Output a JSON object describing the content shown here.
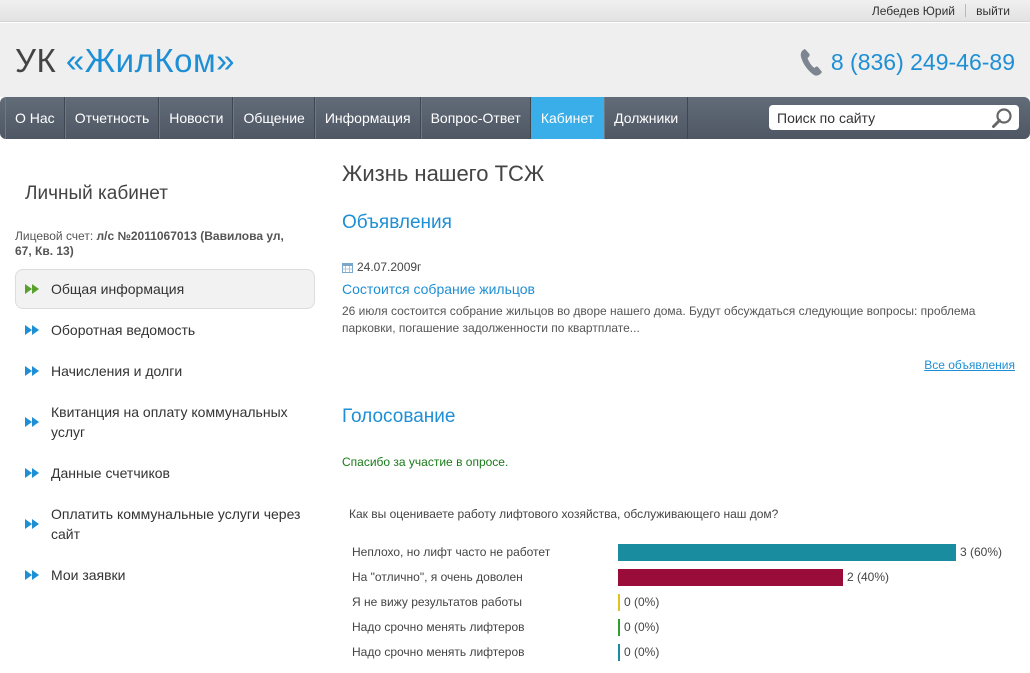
{
  "userbar": {
    "name": "Лебедев Юрий",
    "logout": "выйти"
  },
  "header": {
    "logo_prefix": "УК ",
    "logo_brand": "«ЖилКом»",
    "phone": "8 (836) 249-46-89",
    "phone_icon": "phone-icon"
  },
  "nav": {
    "items": [
      {
        "label": "О Нас"
      },
      {
        "label": "Отчетность"
      },
      {
        "label": "Новости"
      },
      {
        "label": "Общение"
      },
      {
        "label": "Информация"
      },
      {
        "label": "Вопрос-Ответ"
      },
      {
        "label": "Кабинет",
        "active": true
      },
      {
        "label": "Должники"
      }
    ],
    "search_placeholder": "Поиск по сайту",
    "search_icon": "magnifier-icon",
    "active_color": "#39aee8"
  },
  "sidebar": {
    "title": "Личный кабинет",
    "account_label": "Лицевой счет: ",
    "account_value": "л/с №2011067013 (Вавилова ул, 67, Кв. 13)",
    "items": [
      {
        "label": "Общая информация",
        "active": true
      },
      {
        "label": "Оборотная ведомость"
      },
      {
        "label": "Начисления и долги"
      },
      {
        "label": "Квитанция на оплату коммунальных услуг"
      },
      {
        "label": "Данные счетчиков"
      },
      {
        "label": "Оплатить коммунальные услуги через сайт"
      },
      {
        "label": "Мои заявки"
      }
    ],
    "arrow_icon": "double-arrow-icon",
    "active_arrow_color": "#5aa02c",
    "arrow_color": "#1e8fd5"
  },
  "main": {
    "title": "Жизнь нашего ТСЖ",
    "announcements": {
      "title": "Объявления",
      "date": "24.07.2009г",
      "link": "Состоится собрание жильцов",
      "text": "26 июля состоится собрание жильцов во дворе нашего дома. Будут обсуждаться следующие вопросы: проблема парковки, погашение задолженности по квартплате...",
      "all_link": "Все объявления"
    },
    "voting": {
      "title": "Голосование",
      "thanks": "Спасибо за участие в опросе.",
      "question": "Как вы оцениваете работу лифтового хозяйства, обслуживающего наш дом?",
      "options": [
        {
          "label": "Неплохо, но лифт часто не работет",
          "votes": 3,
          "percent": 60,
          "result": "3 (60%)",
          "color": "#1a8ca0"
        },
        {
          "label": "На \"отлично\", я очень доволен",
          "votes": 2,
          "percent": 40,
          "result": "2 (40%)",
          "color": "#9a0c3a"
        },
        {
          "label": "Я не вижу результатов работы",
          "votes": 0,
          "percent": 0,
          "result": "0 (0%)",
          "color": "#e0c41c"
        },
        {
          "label": "Надо срочно менять лифтеров",
          "votes": 0,
          "percent": 0,
          "result": "0 (0%)",
          "color": "#2e9e2e"
        },
        {
          "label": "Надо срочно менять лифтеров",
          "votes": 0,
          "percent": 0,
          "result": "0 (0%)",
          "color": "#1a8ca0"
        }
      ]
    }
  }
}
